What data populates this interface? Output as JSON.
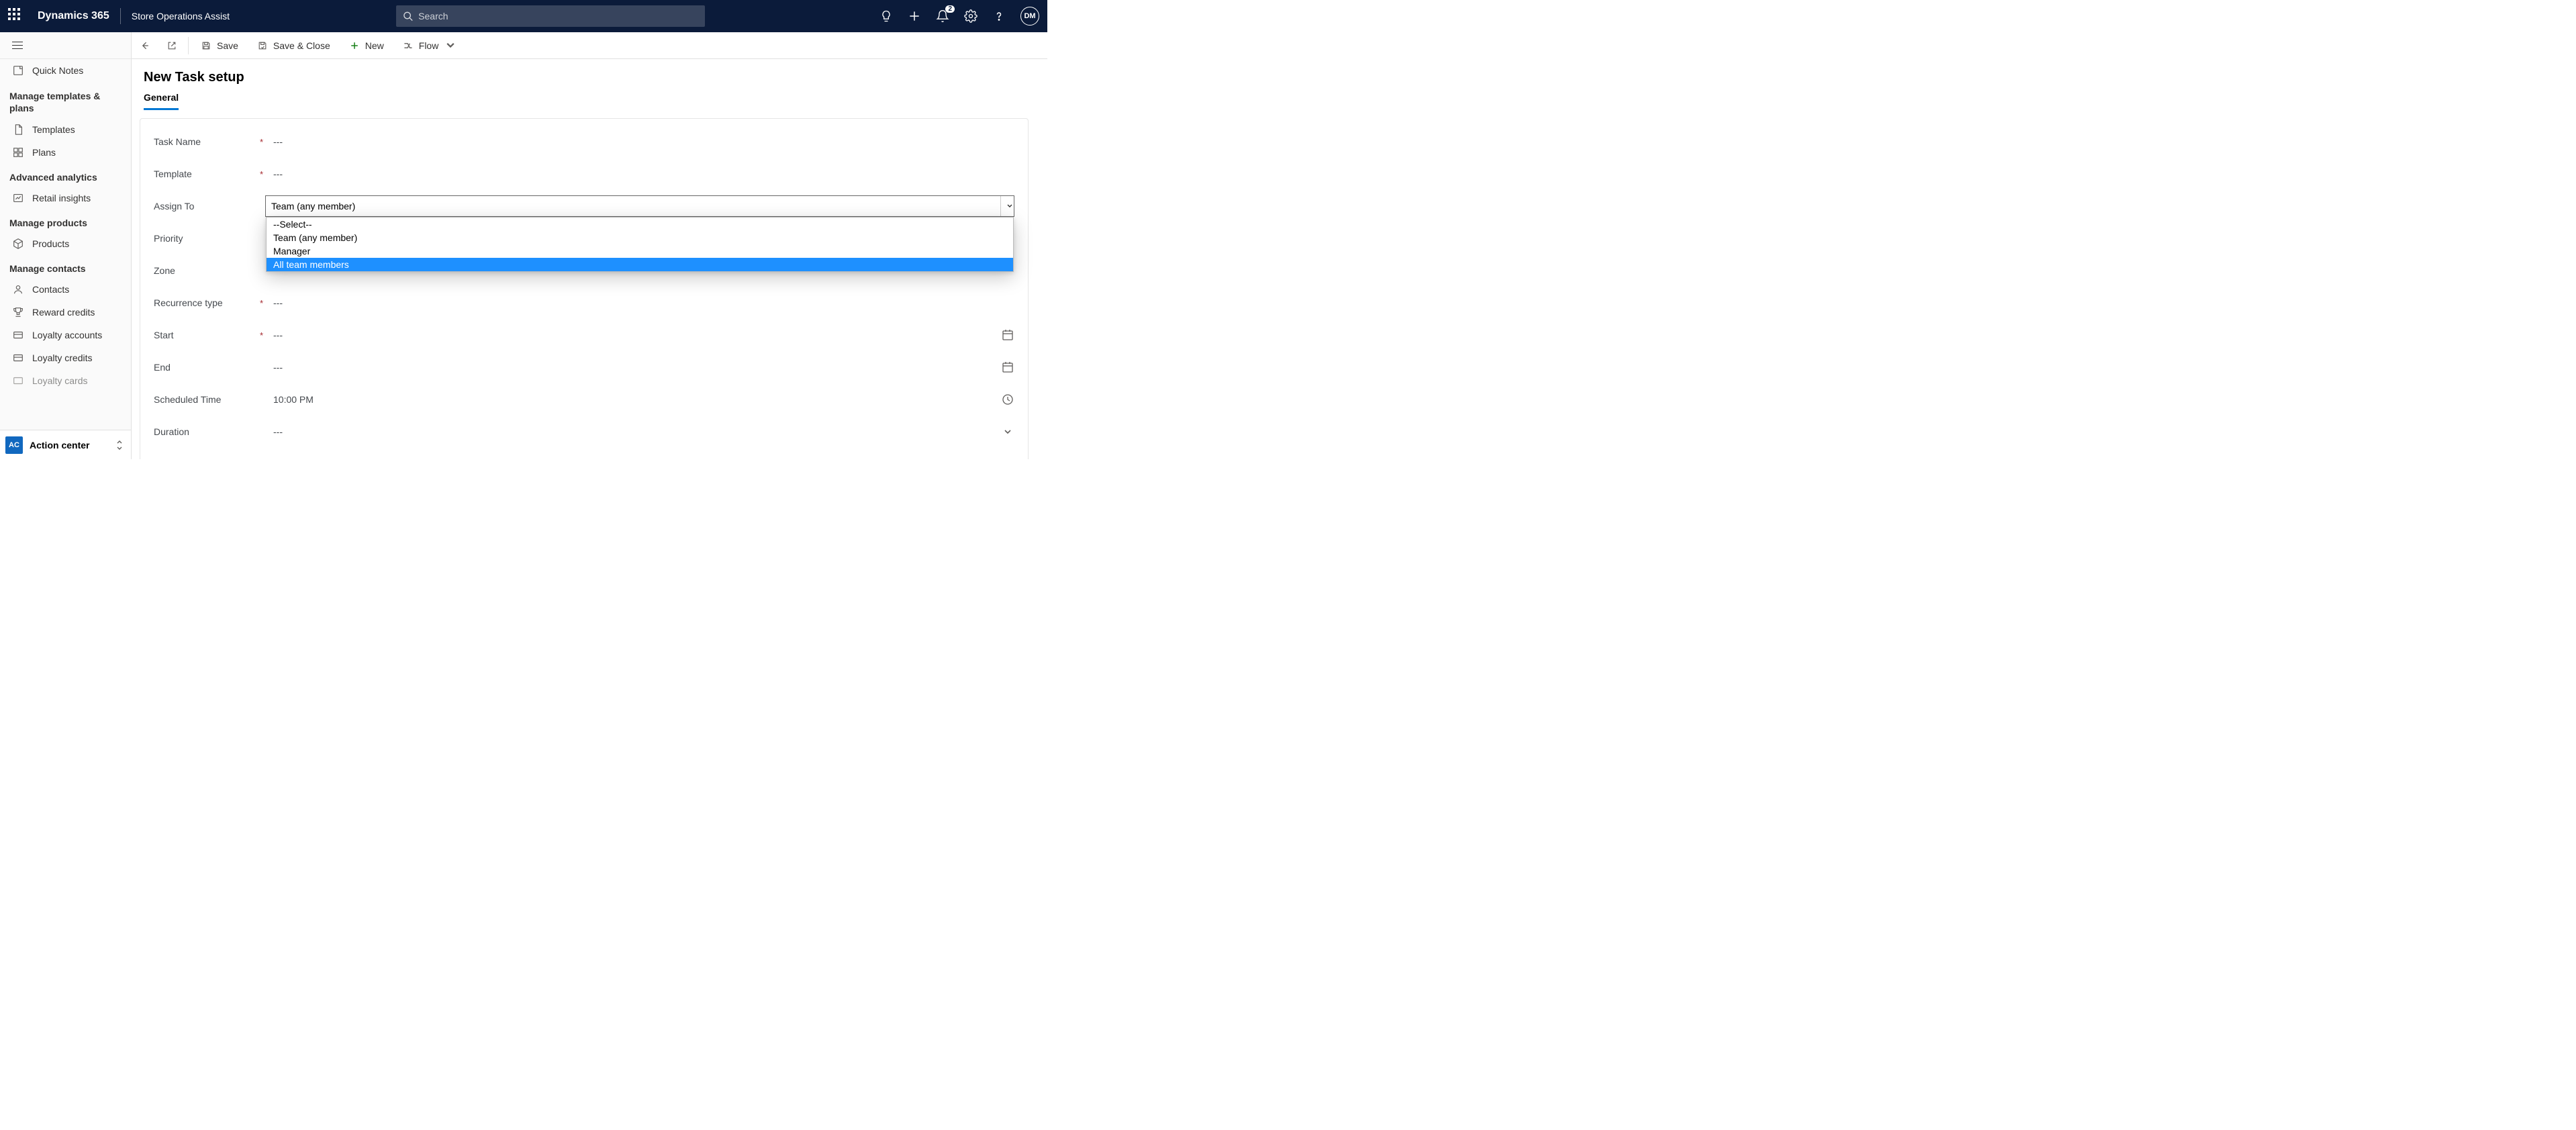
{
  "header": {
    "brand": "Dynamics 365",
    "subtitle": "Store Operations Assist",
    "search_placeholder": "Search",
    "notification_count": "2",
    "user_initials": "DM"
  },
  "sidebar": {
    "quick_notes": "Quick Notes",
    "section_templates": "Manage templates & plans",
    "templates": "Templates",
    "plans": "Plans",
    "section_analytics": "Advanced analytics",
    "retail_insights": "Retail insights",
    "section_products": "Manage products",
    "products": "Products",
    "section_contacts": "Manage contacts",
    "contacts": "Contacts",
    "reward_credits": "Reward credits",
    "loyalty_accounts": "Loyalty accounts",
    "loyalty_credits": "Loyalty credits",
    "loyalty_cards": "Loyalty cards",
    "area_tile": "AC",
    "area_label": "Action center"
  },
  "commands": {
    "save": "Save",
    "save_close": "Save & Close",
    "new": "New",
    "flow": "Flow"
  },
  "page": {
    "title": "New Task setup",
    "tab_general": "General"
  },
  "form": {
    "empty": "---",
    "task_name_label": "Task Name",
    "template_label": "Template",
    "assign_to_label": "Assign To",
    "assign_to_value": "Team (any member)",
    "assign_to_options": {
      "o0": "--Select--",
      "o1": "Team (any member)",
      "o2": "Manager",
      "o3": "All team members"
    },
    "priority_label": "Priority",
    "zone_label": "Zone",
    "recurrence_label": "Recurrence type",
    "start_label": "Start",
    "end_label": "End",
    "scheduled_time_label": "Scheduled Time",
    "scheduled_time_value": "10:00 PM",
    "duration_label": "Duration"
  }
}
